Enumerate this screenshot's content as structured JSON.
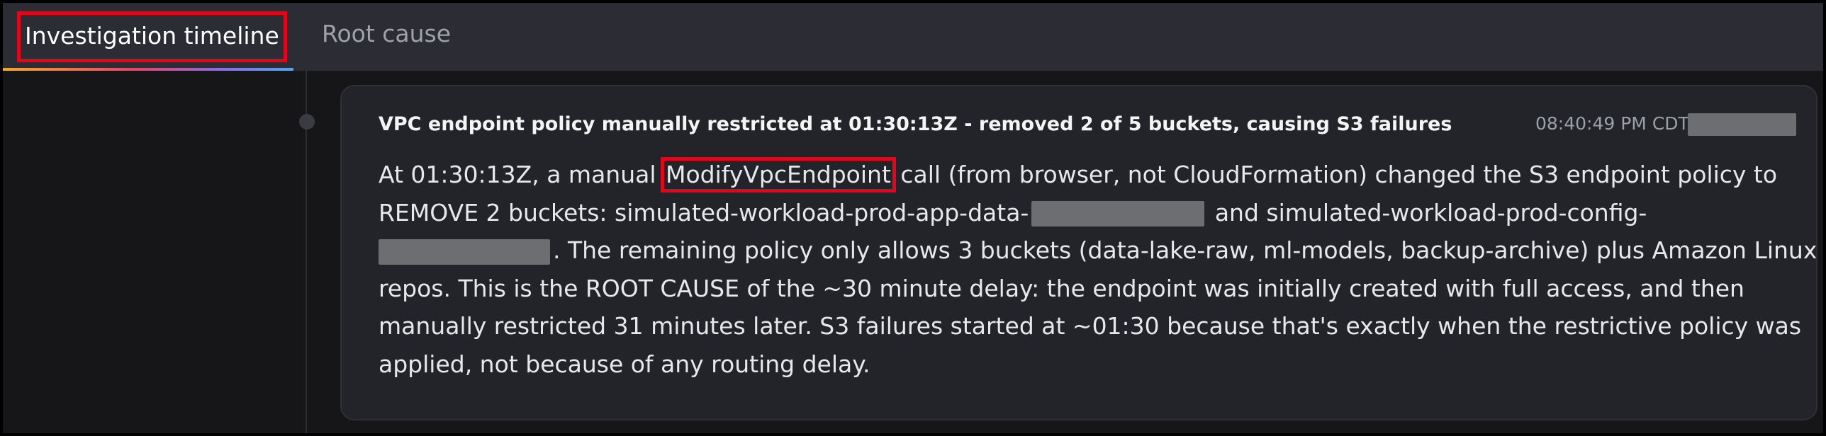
{
  "tabs": [
    {
      "label": "Investigation timeline",
      "active": true
    },
    {
      "label": "Root cause",
      "active": false
    }
  ],
  "event": {
    "title": "VPC endpoint policy manually restricted at 01:30:13Z - removed 2 of 5 buckets, causing S3 failures",
    "time": "08:40:49 PM CDT",
    "body": {
      "l1_before": "At 01:30:13Z, a manual ",
      "l1_highlight": "ModifyVpcEndpoint",
      "l1_after": " call (from browser, not CloudFormation) changed the S3 endpoint policy to",
      "l2_before": "REMOVE 2 buckets: simulated-workload-prod-app-data-",
      "l2_after": " and simulated-workload-prod-config-",
      "l3_after": ". The remaining policy only allows 3 buckets (data-lake-raw, ml-models, backup-archive) plus Amazon Linux",
      "l4": "repos. This is the ROOT CAUSE of the ~30 minute delay: the endpoint was initially created with full access, and then",
      "l5": "manually restricted 31 minutes later. S3 failures started at ~01:30 because that's exactly when the restrictive policy was",
      "l6": "applied, not because of any routing delay."
    }
  },
  "colors": {
    "highlight_border": "#e3061b",
    "tab_bar": "#2c2d34",
    "card": "#232429",
    "redaction": "#6d6e72"
  }
}
